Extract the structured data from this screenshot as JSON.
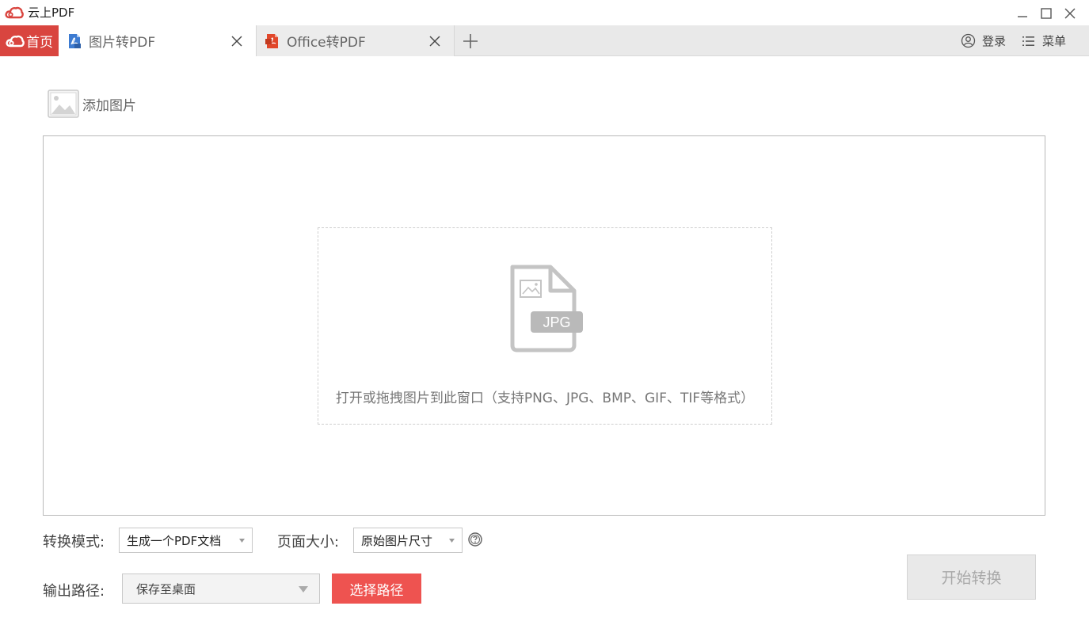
{
  "app": {
    "title": "云上PDF",
    "brand_color": "#d9453f",
    "logo_icon": "cloud-icon"
  },
  "window_controls": {
    "icons": [
      "minimize-icon",
      "maximize-icon",
      "close-icon"
    ]
  },
  "tabs": {
    "home_label": "首页",
    "items": [
      {
        "label": "图片转PDF",
        "icon": "image-pdf-icon",
        "active": true
      },
      {
        "label": "Office转PDF",
        "icon": "office-pdf-icon",
        "active": false
      }
    ],
    "add_icon": "plus-icon"
  },
  "header_right": {
    "login_label": "登录",
    "menu_label": "菜单"
  },
  "toolbar": {
    "add_image_label": "添加图片"
  },
  "drop_zone": {
    "badge": "JPG",
    "hint": "打开或拖拽图片到此窗口（支持PNG、JPG、BMP、GIF、TIF等格式）"
  },
  "settings": {
    "mode_label": "转换模式:",
    "mode_value": "生成一个PDF文档",
    "page_size_label": "页面大小:",
    "page_size_value": "原始图片尺寸",
    "output_label": "输出路径:",
    "output_value": "保存至桌面",
    "choose_path_label": "选择路径",
    "start_label": "开始转换"
  }
}
